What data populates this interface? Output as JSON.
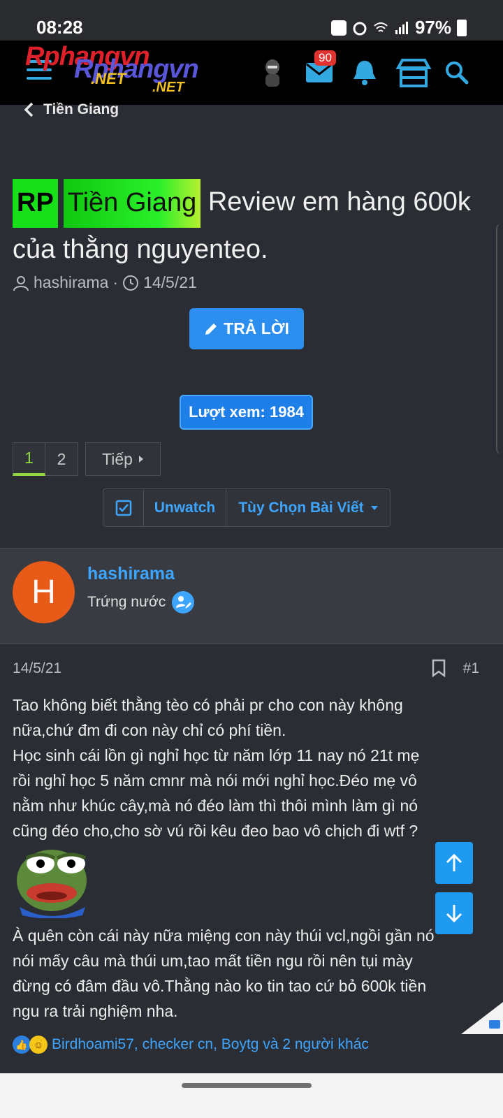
{
  "status_bar": {
    "time": "08:28",
    "battery": "97%"
  },
  "header": {
    "logo_line1": "Rphangvn",
    "logo_line2": "Rphangvn",
    "logo_net1": ".NET",
    "logo_net2": ".NET",
    "inbox_count": "90"
  },
  "breadcrumb": {
    "label": "Tiền Giang"
  },
  "thread": {
    "prefix_rp": "RP",
    "prefix_region": "Tiền Giang",
    "title": "Review em hàng 600k của thằng nguyenteo.",
    "author": "hashirama",
    "date": "14/5/21",
    "reply_label": "TRẢ LỜI",
    "views_label": "Lượt xem: 1984"
  },
  "pagination": {
    "pages": [
      "1",
      "2"
    ],
    "next_label": "Tiếp"
  },
  "actions": {
    "unwatch_label": "Unwatch",
    "options_label": "Tùy Chọn Bài Viết"
  },
  "post": {
    "avatar_letter": "H",
    "username": "hashirama",
    "user_title": "Trứng nước",
    "date": "14/5/21",
    "number": "#1",
    "body_lines": [
      "Tao không biết thằng tèo có phải pr cho con này không",
      "nữa,chứ đm đi con này chỉ có phí tiền.",
      "Học sinh cái lồn gì nghỉ học từ năm lớp 11 nay nó 21t mẹ",
      "rồi nghỉ học 5 năm cmnr mà nói mới nghỉ học.Đéo mẹ vô",
      "nằm như khúc cây,mà nó đéo làm thì thôi mình làm gì nó",
      "cũng đéo cho,cho sờ vú rồi kêu đeo bao vô chịch đi wtf ?"
    ],
    "body2_lines": [
      "À quên còn cái này nữa miệng con này thúi vcl,ngồi gần nó",
      "nói mấy câu mà thúi um,tao mất tiền ngu rồi nên tụi mày",
      "đừng có đâm đầu vô.Thằng nào ko tin tao cứ bỏ 600k tiền",
      "ngu ra trải nghiệm nha."
    ],
    "reactions_text": "Birdhoami57, checker cn, Boytg và 2 người khác"
  },
  "colors": {
    "accent": "#3ea5ff",
    "button": "#2c8ff0",
    "avatar": "#e85a17",
    "tag": "#18e018"
  }
}
